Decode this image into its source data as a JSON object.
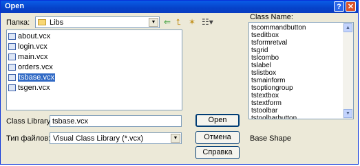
{
  "window": {
    "title": "Open"
  },
  "titlebar": {
    "help": "?",
    "close": "✕"
  },
  "lookin": {
    "label": "Папка:",
    "value": "Libs"
  },
  "files": [
    {
      "name": "about.vcx",
      "selected": false
    },
    {
      "name": "login.vcx",
      "selected": false
    },
    {
      "name": "main.vcx",
      "selected": false
    },
    {
      "name": "orders.vcx",
      "selected": false
    },
    {
      "name": "tsbase.vcx",
      "selected": true
    },
    {
      "name": "tsgen.vcx",
      "selected": false
    }
  ],
  "classlib": {
    "label": "Class Library",
    "value": "tsbase.vcx"
  },
  "filetype": {
    "label": "Тип файлов:",
    "value": "Visual Class Library (*.vcx)"
  },
  "buttons": {
    "open": "Open",
    "cancel": "Отмена",
    "help": "Справка"
  },
  "classname": {
    "label": "Class Name:",
    "items": [
      "tscommandbutton",
      "tseditbox",
      "tsformretval",
      "tsgrid",
      "tslcombo",
      "tslabel",
      "tslistbox",
      "tsmainform",
      "tsoptiongroup",
      "tstextbox",
      "tstextform",
      "tstoolbar",
      "tstoolbarbutton"
    ]
  },
  "baseshape": {
    "label": "Base Shape"
  },
  "icons": {
    "folder": "folder-icon",
    "back": "back-arrow-icon",
    "up": "up-folder-icon",
    "newfolder": "new-folder-icon",
    "view": "view-menu-icon"
  },
  "colors": {
    "titlebar": "#0a5ce6",
    "selection": "#316ac5",
    "dialog": "#ece9d8"
  }
}
